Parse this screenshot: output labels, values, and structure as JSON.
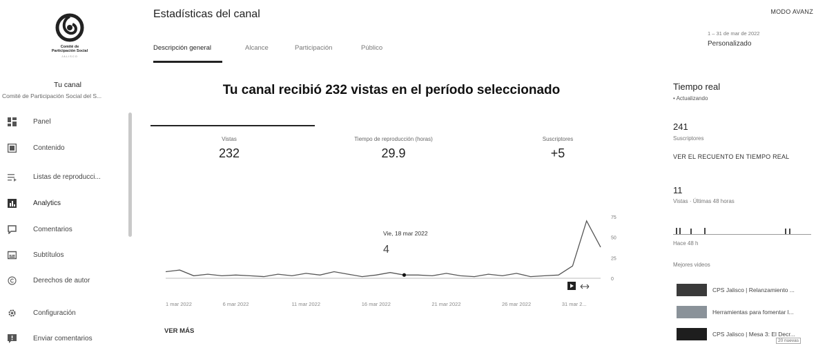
{
  "sidebar": {
    "logo": {
      "line1": "Comité de",
      "line2": "Participación Social",
      "line3": "JALISCO"
    },
    "channel_label": "Tu canal",
    "channel_name": "Comité de Participación Social del S...",
    "items": [
      {
        "label": "Panel",
        "icon": "dashboard-icon"
      },
      {
        "label": "Contenido",
        "icon": "content-icon"
      },
      {
        "label": "Listas de reproducci...",
        "icon": "playlist-icon"
      },
      {
        "label": "Analytics",
        "icon": "analytics-icon"
      },
      {
        "label": "Comentarios",
        "icon": "comments-icon"
      },
      {
        "label": "Subtítulos",
        "icon": "subtitles-icon"
      },
      {
        "label": "Derechos de autor",
        "icon": "copyright-icon"
      },
      {
        "label": "Configuración",
        "icon": "gear-icon"
      },
      {
        "label": "Enviar comentarios",
        "icon": "feedback-icon"
      }
    ]
  },
  "header": {
    "title": "Estadísticas del canal",
    "advanced_mode": "MODO AVANZ",
    "date_range": "1 – 31 de mar de 2022",
    "date_mode": "Personalizado",
    "tabs": [
      {
        "label": "Descripción general"
      },
      {
        "label": "Alcance"
      },
      {
        "label": "Participación"
      },
      {
        "label": "Público"
      }
    ]
  },
  "main": {
    "headline": "Tu canal recibió 232 vistas en el período seleccionado",
    "metrics": [
      {
        "label": "Vistas",
        "value": "232"
      },
      {
        "label": "Tiempo de reproducción (horas)",
        "value": "29.9"
      },
      {
        "label": "Suscriptores",
        "value": "+5"
      }
    ],
    "tooltip": {
      "date": "Vie, 18 mar 2022",
      "value": "4"
    },
    "ver_mas": "VER MÁS"
  },
  "chart_data": {
    "type": "line",
    "x_ticks": [
      "1 mar 2022",
      "6 mar 2022",
      "11 mar 2022",
      "16 mar 2022",
      "21 mar 2022",
      "26 mar 2022",
      "31 mar 2..."
    ],
    "y_ticks": [
      "0",
      "25",
      "50",
      "75"
    ],
    "ylim": [
      0,
      75
    ],
    "x": [
      1,
      2,
      3,
      4,
      5,
      6,
      7,
      8,
      9,
      10,
      11,
      12,
      13,
      14,
      15,
      16,
      17,
      18,
      19,
      20,
      21,
      22,
      23,
      24,
      25,
      26,
      27,
      28,
      29,
      30,
      31
    ],
    "values": [
      8,
      10,
      3,
      5,
      3,
      4,
      3,
      2,
      5,
      3,
      6,
      4,
      8,
      5,
      2,
      4,
      7,
      4,
      4,
      3,
      6,
      3,
      2,
      5,
      3,
      6,
      2,
      3,
      4,
      15,
      70,
      38
    ],
    "series_color": "#555555",
    "highlight_day": 18
  },
  "realtime": {
    "title": "Tiempo real",
    "updating": "• Actualizando",
    "subscribers": "241",
    "subscribers_label": "Suscriptores",
    "view_realtime": "VER EL RECUENTO EN TIEMPO REAL",
    "views": "11",
    "views_label": "Vistas · Últimas 48 horas",
    "ago": "Hace 48 h",
    "top_videos_label": "Mejores videos",
    "videos": [
      {
        "title": "CPS Jalisco | Relanzamiento ..."
      },
      {
        "title": "Herramientas para fomentar l..."
      },
      {
        "title": "CPS Jalisco | Mesa 3: El Decr..."
      }
    ],
    "new_badge": "20 nuevas"
  }
}
